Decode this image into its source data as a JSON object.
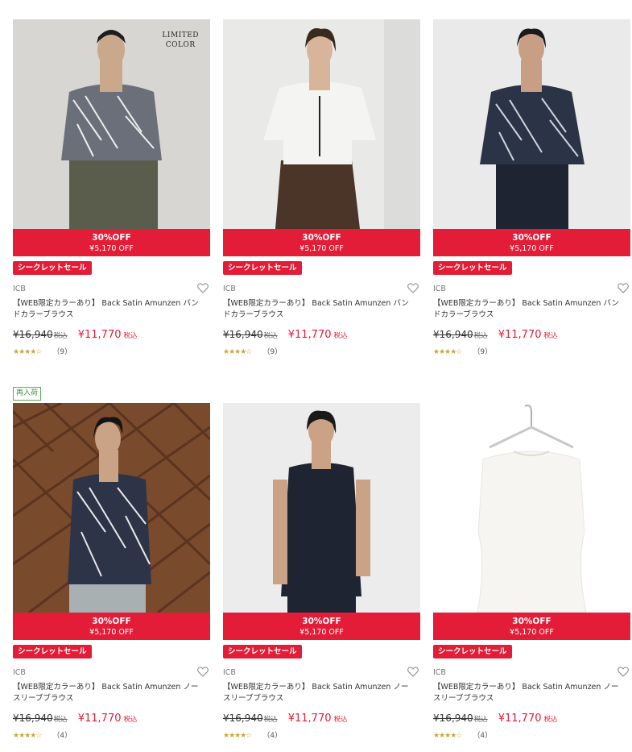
{
  "colors": {
    "sale": "#e31d38",
    "star": "#c8a63a",
    "restock": "#5ea85e"
  },
  "products": [
    {
      "limited_line1": "LIMITED",
      "limited_line2": "COLOR",
      "discount": "30%OFF",
      "discount_amount": "¥5,170 OFF",
      "badge": "シークレットセール",
      "brand": "ICB",
      "name_line1": "【WEB限定カラーあり】 Back Satin Amunzen バン",
      "name_line2": "ドカラーブラウス",
      "old_price": "¥16,940",
      "old_tax": "税込",
      "new_price": "¥11,770",
      "new_tax": "税込",
      "stars": "★★★★☆",
      "review_count": "（9）",
      "icon": "heart-icon"
    },
    {
      "discount": "30%OFF",
      "discount_amount": "¥5,170 OFF",
      "badge": "シークレットセール",
      "brand": "ICB",
      "name_line1": "【WEB限定カラーあり】 Back Satin Amunzen バン",
      "name_line2": "ドカラーブラウス",
      "old_price": "¥16,940",
      "old_tax": "税込",
      "new_price": "¥11,770",
      "new_tax": "税込",
      "stars": "★★★★☆",
      "review_count": "（9）",
      "icon": "heart-icon"
    },
    {
      "discount": "30%OFF",
      "discount_amount": "¥5,170 OFF",
      "badge": "シークレットセール",
      "brand": "ICB",
      "name_line1": "【WEB限定カラーあり】 Back Satin Amunzen バン",
      "name_line2": "ドカラーブラウス",
      "old_price": "¥16,940",
      "old_tax": "税込",
      "new_price": "¥11,770",
      "new_tax": "税込",
      "stars": "★★★★☆",
      "review_count": "（9）",
      "icon": "heart-icon"
    },
    {
      "restock": "再入荷",
      "discount": "30%OFF",
      "discount_amount": "¥5,170 OFF",
      "badge": "シークレットセール",
      "brand": "ICB",
      "name_line1": "【WEB限定カラーあり】 Back Satin Amunzen ノー",
      "name_line2": "スリーブブラウス",
      "old_price": "¥16,940",
      "old_tax": "税込",
      "new_price": "¥11,770",
      "new_tax": "税込",
      "stars": "★★★★☆",
      "review_count": "（4）",
      "icon": "heart-icon"
    },
    {
      "discount": "30%OFF",
      "discount_amount": "¥5,170 OFF",
      "badge": "シークレットセール",
      "brand": "ICB",
      "name_line1": "【WEB限定カラーあり】 Back Satin Amunzen ノー",
      "name_line2": "スリーブブラウス",
      "old_price": "¥16,940",
      "old_tax": "税込",
      "new_price": "¥11,770",
      "new_tax": "税込",
      "stars": "★★★★☆",
      "review_count": "（4）",
      "icon": "heart-icon"
    },
    {
      "discount": "30%OFF",
      "discount_amount": "¥5,170 OFF",
      "badge": "シークレットセール",
      "brand": "ICB",
      "name_line1": "【WEB限定カラーあり】 Back Satin Amunzen ノー",
      "name_line2": "スリーブブラウス",
      "old_price": "¥16,940",
      "old_tax": "税込",
      "new_price": "¥11,770",
      "new_tax": "税込",
      "stars": "★★★★☆",
      "review_count": "（4）",
      "icon": "heart-icon"
    }
  ]
}
